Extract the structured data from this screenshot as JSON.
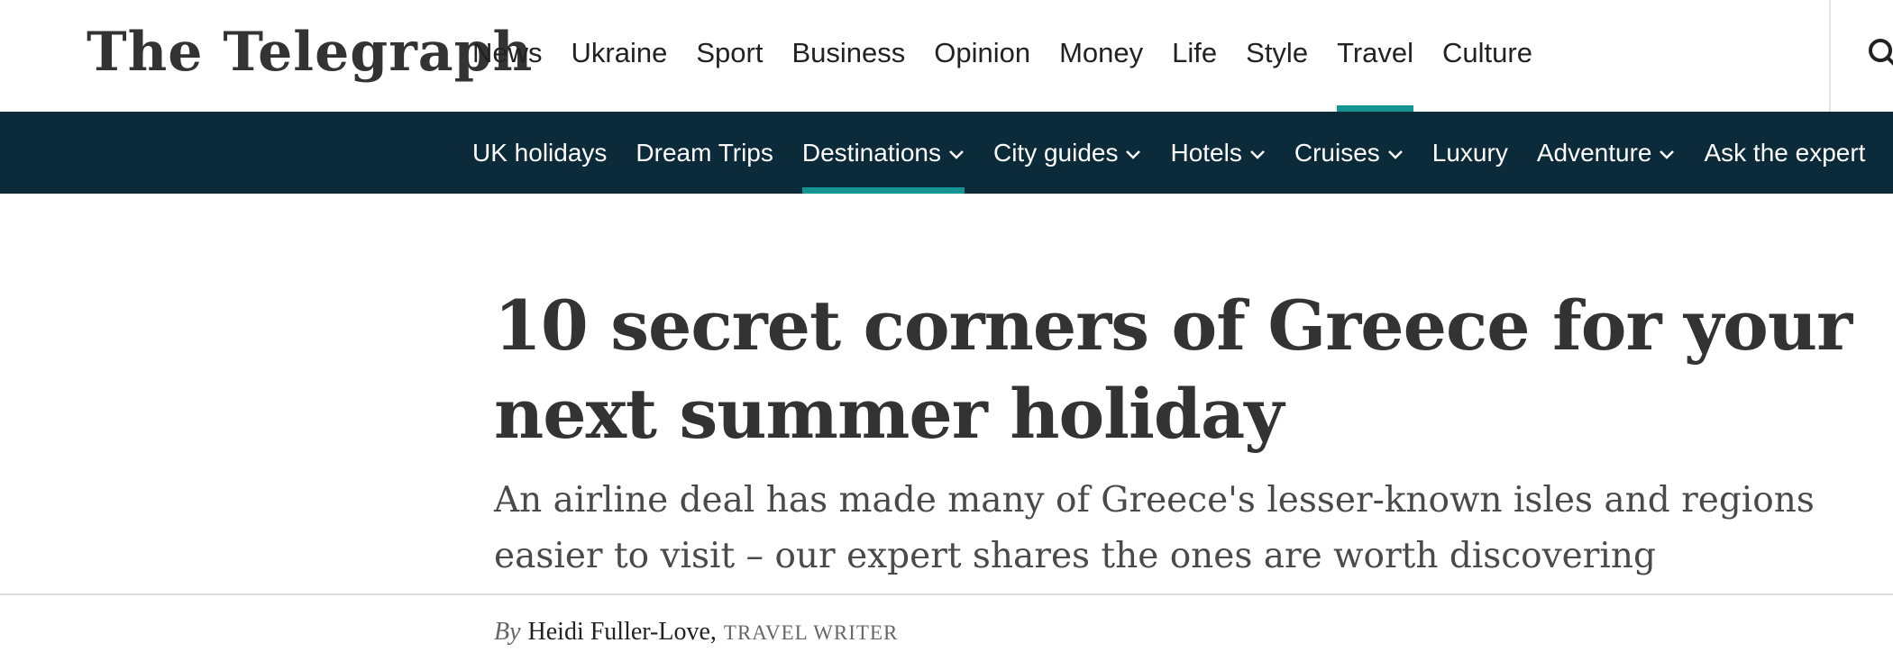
{
  "brand": {
    "name": "The Telegraph",
    "accent_color": "#159494",
    "nav_background": "#0b2a3a"
  },
  "main_nav": {
    "items": [
      {
        "label": "News"
      },
      {
        "label": "Ukraine"
      },
      {
        "label": "Sport"
      },
      {
        "label": "Business"
      },
      {
        "label": "Opinion"
      },
      {
        "label": "Money"
      },
      {
        "label": "Life"
      },
      {
        "label": "Style"
      },
      {
        "label": "Travel",
        "active": true
      },
      {
        "label": "Culture"
      }
    ],
    "search_icon": "search-icon"
  },
  "section_nav": {
    "items": [
      {
        "label": "UK holidays"
      },
      {
        "label": "Dream Trips"
      },
      {
        "label": "Destinations",
        "dropdown": true,
        "active": true
      },
      {
        "label": "City guides",
        "dropdown": true
      },
      {
        "label": "Hotels",
        "dropdown": true
      },
      {
        "label": "Cruises",
        "dropdown": true
      },
      {
        "label": "Luxury"
      },
      {
        "label": "Adventure",
        "dropdown": true
      },
      {
        "label": "Ask the expert"
      }
    ]
  },
  "article": {
    "headline": "10 secret corners of Greece for your next summer holiday",
    "standfirst": "An airline deal has made many of Greece's lesser-known isles and regions easier to visit – our expert shares the ones are worth discovering",
    "byline": {
      "prefix": "By",
      "author": "Heidi Fuller-Love",
      "separator": ",",
      "role": "TRAVEL WRITER"
    }
  }
}
